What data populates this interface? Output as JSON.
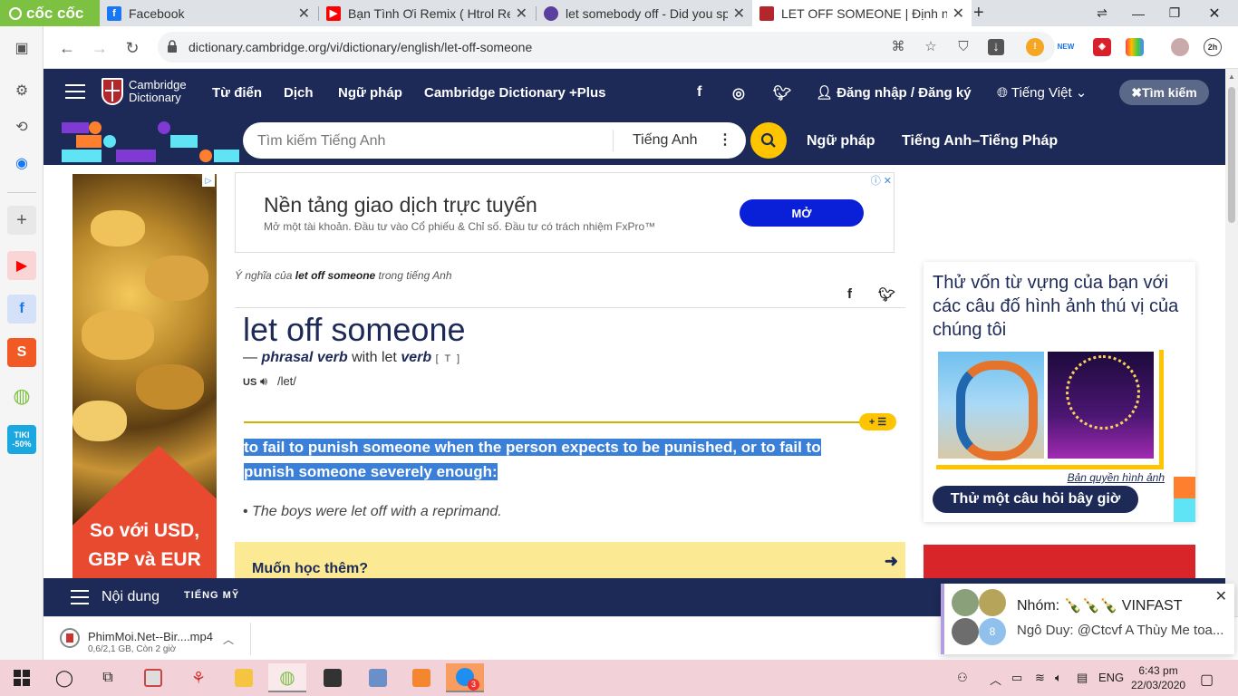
{
  "browser": {
    "brand": "cốc cốc",
    "tabs": [
      {
        "title": "Facebook"
      },
      {
        "title": "Bạn Tình Ơi Remix ( Htrol Remix"
      },
      {
        "title": "let somebody off - Did you spe"
      },
      {
        "title": "LET OFF SOMEONE | Định nghĩa"
      }
    ],
    "new_tab": "+",
    "url": "dictionary.cambridge.org/vi/dictionary/english/let-off-someone",
    "ext_new_badge": "NEW",
    "timer_badge": "2h"
  },
  "site": {
    "logo_line1": "Cambridge",
    "logo_line2": "Dictionary",
    "nav": [
      "Từ điển",
      "Dịch",
      "Ngữ pháp",
      "Cambridge Dictionary +Plus"
    ],
    "login": "Đăng nhập / Đăng ký",
    "language": "Tiếng Việt",
    "search_button": "Tìm kiếm",
    "search_placeholder": "Tìm kiếm Tiếng Anh",
    "search_lang": "Tiếng Anh",
    "subnav": [
      "Ngữ pháp",
      "Tiếng Anh–Tiếng Pháp"
    ]
  },
  "top_ad": {
    "headline": "Nền tảng giao dịch trực tuyến",
    "sub": "Mở một tài khoản. Đầu tư vào Cổ phiếu & Chỉ số. Đầu tư có trách nhiệm FxPro™",
    "cta": "MỞ"
  },
  "left_ad": {
    "text_line1": "So với USD,",
    "text_line2": "GBP và EUR"
  },
  "entry": {
    "meaning_prefix": "Ý nghĩa của",
    "meaning_word": "let off someone",
    "meaning_suffix": "trong tiếng Anh",
    "headword": "let off someone",
    "dash": "—",
    "pos1": "phrasal verb",
    "with": "with let",
    "pos2": "verb",
    "grammar": "[ T ]",
    "region": "US",
    "ipa": "/let/",
    "badge": "+ ☰",
    "definition_line1": "to fail to punish someone when the person expects to be punished, or to fail to",
    "definition_line2": "punish someone severely enough:",
    "example": "The boys were let off with a reprimand.",
    "learn_more": "Muốn học thêm?"
  },
  "quiz": {
    "title": "Thử vốn từ vựng của bạn với các câu đố hình ảnh thú vị của chúng tôi",
    "copyright": "Bản quyền hình ảnh",
    "button": "Thử một câu hỏi bây giờ"
  },
  "sticky": {
    "contents": "Nội dung",
    "region": "TIẾNG MỸ"
  },
  "download": {
    "filename": "PhimMoi.Net--Bir....mp4",
    "status": "0,6/2,1 GB, Còn 2 giờ"
  },
  "notification": {
    "group": "Nhóm: 🍾🍾🍾 VINFAST",
    "message": "Ngô Duy: @Ctcvf A Thùy Me toa...",
    "count": "8"
  },
  "taskbar": {
    "lang": "ENG",
    "time": "6:43 pm",
    "date": "22/03/2020",
    "zalo_badge": "3"
  },
  "sidebar_tiki": "TIKI -50%"
}
